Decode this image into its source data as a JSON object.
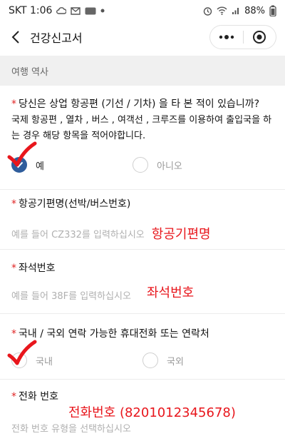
{
  "status_bar": {
    "carrier_time": "SKT 1:06",
    "battery": "88%"
  },
  "nav": {
    "title": "건강신고서"
  },
  "section": {
    "title": "여행 역사"
  },
  "question1": {
    "required_mark": "*",
    "label": "당신은 상업 항공편 (기선 / 기차) 을 타 본 적이 있습니까?",
    "description": "국제 항공편 , 열차 , 버스 , 여객선 , 크루즈를 이용하여 출입국을 하는 경우 해당 항목을 적어야합니다.",
    "options": [
      {
        "label": "예",
        "selected": true
      },
      {
        "label": "아니오",
        "selected": false
      }
    ]
  },
  "flight_field": {
    "required_mark": "*",
    "label": "항공기편명(선박/버스번호)",
    "placeholder": "예를 들어 CZ332를 입력하십시오",
    "annotation": "항공기편명"
  },
  "seat_field": {
    "required_mark": "*",
    "label": "좌석번호",
    "placeholder": "예를 들어 38F를 입력하십시오",
    "annotation": "좌석번호"
  },
  "contact_field": {
    "required_mark": "*",
    "label": "국내 / 국외 연락 가능한 휴대전화 또는 연락처",
    "options": [
      {
        "label": "국내",
        "selected": false
      },
      {
        "label": "국외",
        "selected": false
      }
    ]
  },
  "phone_field": {
    "required_mark": "*",
    "label": "전화 번호",
    "placeholder": "전화 번호 유형을 선택하십시오",
    "annotation": "전화번호 (8201012345678)"
  },
  "colors": {
    "accent": "#2f5d9c",
    "required": "#e02424",
    "annotation": "#e8161c",
    "placeholder": "#b0b0b0"
  }
}
